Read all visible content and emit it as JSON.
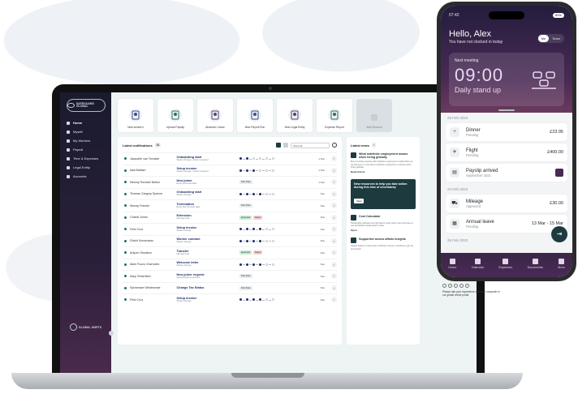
{
  "desktop": {
    "brand": "SAFEGUARD GLOBAL",
    "footer_brand": "GLOBAL SHIFTS",
    "nav": [
      {
        "label": "Home",
        "icon": "home-icon"
      },
      {
        "label": "Myself",
        "icon": "user-icon"
      },
      {
        "label": "My Workers",
        "icon": "users-icon"
      },
      {
        "label": "Payroll",
        "icon": "dollar-icon"
      },
      {
        "label": "Time & Expenses",
        "icon": "clock-icon"
      },
      {
        "label": "Legal Entity",
        "icon": "building-icon"
      },
      {
        "label": "Accounts",
        "icon": "accounts-icon"
      }
    ],
    "tiles": [
      "New worker's",
      "Upload Payslip",
      "Absence/ Leave",
      "New Payroll Run",
      "New Legal Entity",
      "Expense Report",
      "Add Shortcut"
    ],
    "notifications": {
      "title": "Latest notifications",
      "count": "34",
      "filter": "Show all",
      "rows": [
        {
          "name": "Jacquelin van Torvalse",
          "event": "Onboarding start",
          "sub": "Status change - Action required",
          "tags": [],
          "progress": 1,
          "time": "1 Nov"
        },
        {
          "name": "Issa Baltazh",
          "event": "Setup income",
          "sub": "Status change - Action required",
          "tags": [],
          "progress": 2,
          "time": "1 Nov"
        },
        {
          "name": "Melony Rochael Nelton",
          "event": "New joiner",
          "sub": "Enter personal data",
          "tags": [
            {
              "t": "Start Date",
              "c": ""
            }
          ],
          "progress": 0,
          "time": "1 Nov"
        },
        {
          "name": "Thomas Gregory Spence",
          "event": "Onboarding start",
          "sub": "Status change",
          "tags": [],
          "progress": 3,
          "time": "Nov"
        },
        {
          "name": "Murray Francis",
          "event": "Termination",
          "sub": "Enter last forecast date",
          "tags": [
            {
              "t": "Start Date",
              "c": ""
            }
          ],
          "progress": 0,
          "time": "Nov"
        },
        {
          "name": "Chanel Jones",
          "event": "Extension",
          "sub": "HR approval",
          "tags": [
            {
              "t": "Approved",
              "c": "green"
            },
            {
              "t": "Reject",
              "c": "red"
            }
          ],
          "progress": 0,
          "time": "Nov"
        },
        {
          "name": "Felic Cruz",
          "event": "Setup invoice",
          "sub": "Status change",
          "tags": [],
          "progress": 3,
          "time": "Nov"
        },
        {
          "name": "Dhichi Konomatsu",
          "event": "Worker contract",
          "sub": "Status change",
          "tags": [],
          "progress": 3,
          "time": "Nov"
        },
        {
          "name": "Artyom Stovakov",
          "event": "Transfer",
          "sub": "HR approval",
          "tags": [
            {
              "t": "Approved",
              "c": "green"
            },
            {
              "t": "Reject",
              "c": "red"
            }
          ],
          "progress": 0,
          "time": "Nov"
        },
        {
          "name": "Alain Fuozo Charnolez",
          "event": "Welcome letter",
          "sub": "Status change",
          "tags": [],
          "progress": 3,
          "time": "Nov"
        },
        {
          "name": "Mary Tenterfield",
          "event": "New joiner request",
          "sub": "Upload signed contract",
          "tags": [
            {
              "t": "Start Date",
              "c": ""
            }
          ],
          "progress": 0,
          "time": "Nov"
        },
        {
          "name": "Sylvanowe Windeumae",
          "event": "Change Tax Status",
          "sub": "",
          "tags": [
            {
              "t": "Start Date",
              "c": ""
            }
          ],
          "progress": 0,
          "time": "Nov"
        },
        {
          "name": "Felic Cruz",
          "event": "Setup invoice",
          "sub": "Status change",
          "tags": [],
          "progress": 3,
          "time": "Nov"
        }
      ]
    },
    "news": {
      "title": "Latest news",
      "items": [
        {
          "title": "What indefinite employment means when hiring globally",
          "body": "Most countries operate with indefinite employment relationships as we will soon in more about indefinite employment contracts when hiring globally.",
          "link": "Read Article"
        },
        {
          "title": "New resources to help you take action during this time of uncertainty",
          "body": "",
          "link": "View"
        },
        {
          "title": "Cost Calculator",
          "body": "Sustainable pathway into tight labour types policy uses and easy to use all thisfaces legal areas or data.",
          "link": "Open"
        },
        {
          "title": "Supportive across affairs Insights",
          "body": "Helpful feature to help lead to effective choices, countries to get set and growth.",
          "link": ""
        }
      ]
    }
  },
  "phone": {
    "time": "07:42",
    "battery": "89%",
    "greeting": "Hello, Alex",
    "clock_status": "You have not clocked in today",
    "toggle": [
      "Me",
      "Team"
    ],
    "meeting": {
      "label": "Next meeting",
      "time": "09:00",
      "name": "Daily stand up"
    },
    "groups": [
      {
        "date": "28 Feb 2022",
        "items": [
          {
            "title": "Dinner",
            "sub": "Pending",
            "value": "£23.95",
            "icon": "fork-icon"
          },
          {
            "title": "Flight",
            "sub": "Pending",
            "value": "£400.00",
            "icon": "plane-icon"
          },
          {
            "title": "Payslip arrived",
            "sub": "September 2021",
            "value": "",
            "icon": "payslip-icon"
          }
        ]
      },
      {
        "date": "24 Feb 2022",
        "items": [
          {
            "title": "Mileage",
            "sub": "Approved",
            "value": "£30.00",
            "icon": "car-icon"
          },
          {
            "title": "Annual leave",
            "sub": "Pending",
            "value": "13 Mar - 15 Mar",
            "icon": "calendar-icon"
          }
        ]
      },
      {
        "date": "25 Feb 2022",
        "items": []
      }
    ],
    "tabs": [
      "Home",
      "Calendar",
      "Expenses",
      "Documents",
      "More"
    ],
    "promo": "Please rate your experience with your computer in our global online portal"
  }
}
